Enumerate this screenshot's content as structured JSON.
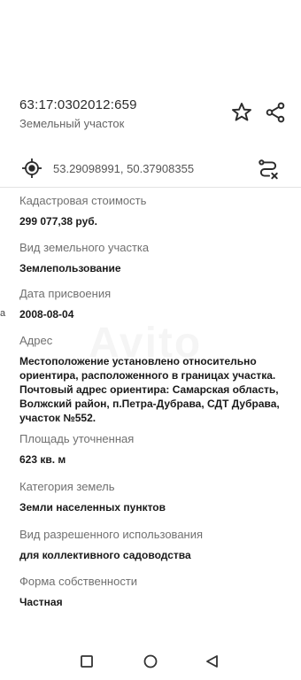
{
  "header": {
    "cadastral_number": "63:17:0302012:659",
    "object_type": "Земельный участок"
  },
  "location": {
    "coordinates": "53.29098991, 50.37908355"
  },
  "fields": [
    {
      "label": "Кадастровая стоимость",
      "value": "299 077,38 руб."
    },
    {
      "label": "Вид земельного участка",
      "value": "Землепользование"
    },
    {
      "label": "Дата присвоения",
      "value": "2008-08-04"
    },
    {
      "label": "Адрес",
      "value": "Местоположение установлено относительно ориентира, расположенного в границах участка. Почтовый адрес ориентира: Самарская область, Волжский район, п.Петра-Дубрава, СДТ Дубрава, участок №552."
    },
    {
      "label": "Площадь уточненная",
      "value": "623 кв. м"
    },
    {
      "label": "Категория земель",
      "value": "Земли населенных пунктов"
    },
    {
      "label": "Вид разрешенного использования",
      "value": "для коллективного садоводства"
    },
    {
      "label": "Форма собственности",
      "value": "Частная"
    }
  ],
  "edge_text": "a",
  "watermark": "Avito",
  "icons": {
    "favorite": "star-icon",
    "share": "share-icon",
    "locate": "target-icon",
    "route": "route-icon",
    "nav_recent": "square-icon",
    "nav_home": "circle-icon",
    "nav_back": "triangle-back-icon"
  },
  "colors": {
    "label": "#707070",
    "value": "#1a1a1a",
    "icon": "#2b2b2b"
  }
}
